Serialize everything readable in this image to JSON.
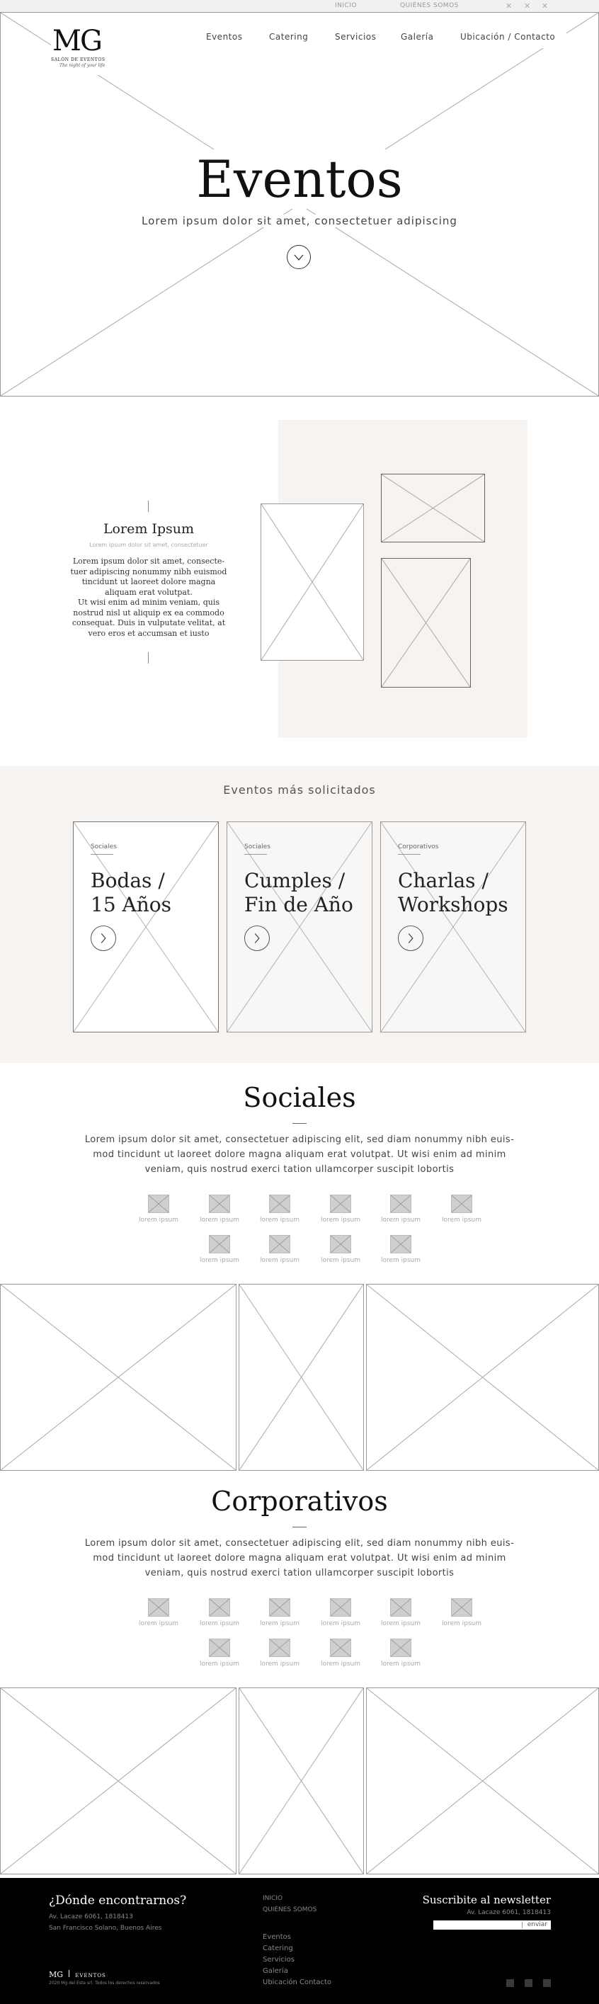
{
  "topbar": {
    "links": [
      "INICIO",
      "QUIÉNES SOMOS"
    ],
    "icons": [
      "social-icon-1",
      "social-icon-2",
      "social-icon-3"
    ]
  },
  "logo": {
    "mark": "MG",
    "line1": "SALÓN DE EVENTOS",
    "tagline": "The night of your life"
  },
  "nav": [
    "Eventos",
    "Catering",
    "Servicios",
    "Galería",
    "Ubicación / Contacto"
  ],
  "hero": {
    "title": "Eventos",
    "subtitle": "Lorem ipsum dolor sit amet, consectetuer adipiscing"
  },
  "about": {
    "title": "Lorem Ipsum",
    "subtitle": "Lorem ipsum dolor sit amet, consectetuer",
    "lines": [
      "Lorem ipsum dolor sit amet, consecte-",
      "tuer adipiscing nonummy nibh euismod",
      "tincidunt ut laoreet dolore magna",
      "aliquam erat volutpat.",
      "Ut wisi enim ad minim veniam, quis",
      "nostrud nisl ut aliquip ex ea commodo",
      "consequat. Duis in vulputate velitat, at",
      "vero eros et accumsan et iusto"
    ]
  },
  "popular": {
    "title": "Eventos más solicitados",
    "cards": [
      {
        "category": "Sociales",
        "title1": "Bodas /",
        "title2": "15 Años"
      },
      {
        "category": "Sociales",
        "title1": "Cumples /",
        "title2": "Fin de Año"
      },
      {
        "category": "Corporativos",
        "title1": "Charlas /",
        "title2": "Workshops"
      }
    ]
  },
  "sociales": {
    "title": "Sociales",
    "lines": [
      "Lorem ipsum dolor sit amet, consectetuer adipiscing elit, sed diam nonummy nibh euis-",
      "mod tincidunt ut laoreet dolore magna aliquam erat volutpat. Ut wisi enim ad minim",
      "veniam, quis nostrud exerci tation ullamcorper suscipit lobortis"
    ],
    "labels": [
      "lorem ipsum",
      "lorem ipsum",
      "lorem ipsum",
      "lorem ipsum",
      "lorem ipsum",
      "lorem ipsum",
      "lorem ipsum",
      "lorem ipsum",
      "lorem ipsum",
      "lorem ipsum"
    ]
  },
  "corporativos": {
    "title": "Corporativos",
    "lines": [
      "Lorem ipsum dolor sit amet, consectetuer adipiscing elit, sed diam nonummy nibh euis-",
      "mod tincidunt ut laoreet dolore magna aliquam erat volutpat. Ut wisi enim ad minim",
      "veniam, quis nostrud exerci tation ullamcorper suscipit lobortis"
    ],
    "labels": [
      "lorem ipsum",
      "lorem ipsum",
      "lorem ipsum",
      "lorem ipsum",
      "lorem ipsum",
      "lorem ipsum",
      "lorem ipsum",
      "lorem ipsum",
      "lorem ipsum",
      "lorem ipsum"
    ]
  },
  "footer": {
    "where_title": "¿Dónde encontrarnos?",
    "address1": "Av. Lacaze 6061, 1818413",
    "address2": "San Francisco Solano, Buenos Aires",
    "links_top": [
      "INICIO",
      "QUIÉNES SOMOS"
    ],
    "links": [
      "Eventos",
      "Catering",
      "Servicios",
      "Galería",
      "Ubicación Contacto"
    ],
    "newsletter_title": "Suscribite al newsletter",
    "newsletter_sub": "Av. Lacaze 6061, 1818413",
    "send": "enviar",
    "logo_mark": "MG",
    "logo_text": "EVENTOS",
    "copyright": "2020 Mg del Este srl. Todos los derechos reservados",
    "social_icons": [
      "social-icon-1",
      "social-icon-2",
      "social-icon-3"
    ]
  }
}
